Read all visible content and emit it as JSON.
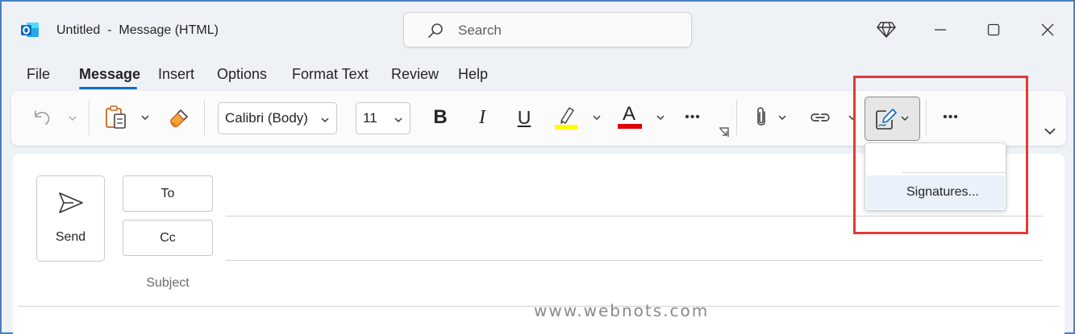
{
  "title_bar": {
    "window_title": "Untitled  -  Message (HTML)",
    "search_placeholder": "Search",
    "app_icon": "outlook-icon",
    "buttons": [
      "diamond-icon",
      "minimize-icon",
      "maximize-icon",
      "close-icon"
    ]
  },
  "menu": {
    "items": [
      "File",
      "Message",
      "Insert",
      "Options",
      "Format Text",
      "Review",
      "Help"
    ],
    "active": "Message"
  },
  "ribbon": {
    "font_name": "Calibri (Body)",
    "font_size": "11",
    "bold": "B",
    "italic": "I",
    "underline": "U",
    "font_color_letter": "A",
    "more": "•••",
    "icons": [
      "undo-icon",
      "paste-icon",
      "format-painter-icon",
      "highlight-icon",
      "font-color-icon",
      "attach-icon",
      "link-icon",
      "signature-icon",
      "expand-ribbon-icon"
    ],
    "colors": {
      "highlight": "#ffff00",
      "font_color": "#e00000",
      "accent": "#0f6cbd"
    }
  },
  "signature_menu": {
    "item": "Signatures..."
  },
  "compose": {
    "send_label": "Send",
    "to_label": "To",
    "cc_label": "Cc",
    "subject_label": "Subject"
  },
  "watermark": "www.webnots.com",
  "annotation_color": "#e53935"
}
